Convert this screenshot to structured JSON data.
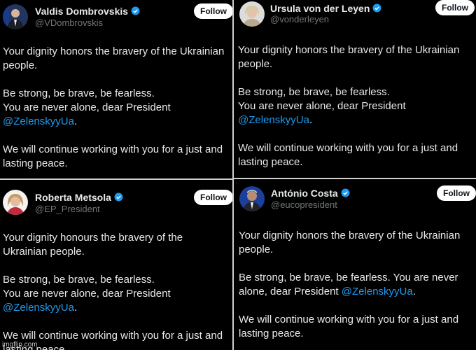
{
  "posts": [
    {
      "name": "Valdis Dombrovskis",
      "handle": "@VDombrovskis",
      "follow_label": "Follow",
      "line1": "Your dignity honors the bravery of the Ukrainian people.",
      "line2": "Be strong, be brave, be fearless.",
      "line3": "You are never alone, dear President",
      "mention": "@ZelenskyyUa",
      "mention_suffix": ".",
      "line4": "We will continue working with you for a just and lasting peace."
    },
    {
      "name": "Ursula von der Leyen",
      "handle": "@vonderleyen",
      "follow_label": "Follow",
      "line1": "Your dignity honors the bravery of the Ukrainian people.",
      "line2": "Be strong, be brave, be fearless.",
      "line3": "You are never alone, dear President",
      "mention": "@ZelenskyyUa",
      "mention_suffix": ".",
      "line4": "We will continue working with you for a just and lasting peace."
    },
    {
      "name": "Roberta Metsola",
      "handle": "@EP_President",
      "follow_label": "Follow",
      "line1": "Your dignity honours the bravery of the Ukrainian people.",
      "line2": "Be strong, be brave, be fearless.",
      "line3": "You are never alone, dear President",
      "mention": "@ZelenskyyUa",
      "mention_suffix": ".",
      "line4": "We will continue working with you for a just and lasting peace."
    },
    {
      "name": "António Costa",
      "handle": "@eucopresident",
      "follow_label": "Follow",
      "line1": "Your dignity honors the bravery of the Ukrainian people.",
      "line2": "Be strong, be brave, be fearless. You are never alone, dear President",
      "mention": "@ZelenskyyUa",
      "mention_suffix": ".",
      "line4": "We will continue working with you for a just and lasting peace."
    }
  ],
  "watermark": "imgflip.com",
  "colors": {
    "background": "#000000",
    "text": "#e7e9ea",
    "muted": "#71767b",
    "mention": "#1d9bf0",
    "verified": "#1d9bf0"
  },
  "icons": {
    "verified": "verified-badge-icon"
  }
}
